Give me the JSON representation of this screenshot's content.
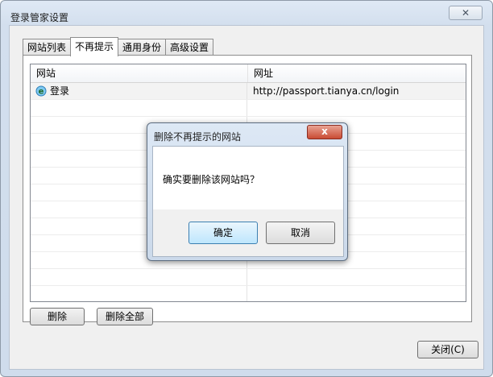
{
  "window": {
    "title": "登录管家设置",
    "close_glyph": "✕"
  },
  "tabs": [
    {
      "label": "网站列表",
      "active": false
    },
    {
      "label": "不再提示",
      "active": true
    },
    {
      "label": "通用身份",
      "active": false
    },
    {
      "label": "高级设置",
      "active": false
    }
  ],
  "list": {
    "columns": [
      "网站",
      "网址"
    ],
    "rows": [
      {
        "site": "登录",
        "url": "http://passport.tianya.cn/login",
        "icon": "ie-globe-icon"
      }
    ]
  },
  "buttons": {
    "delete": "删除",
    "delete_all": "删除全部",
    "close": "关闭(C)"
  },
  "dialog": {
    "title": "删除不再提示的网站",
    "message": "确实要删除该网站吗？",
    "ok": "确定",
    "cancel": "取消",
    "close_glyph": "x"
  }
}
